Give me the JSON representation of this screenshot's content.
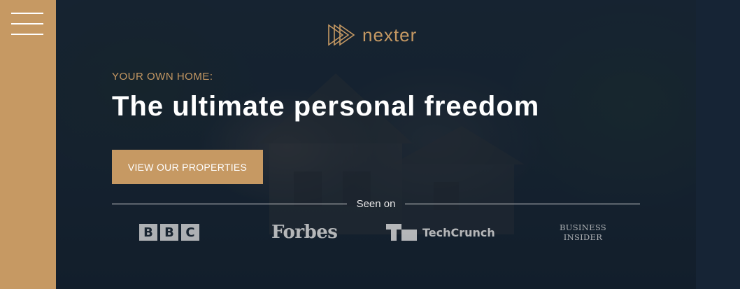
{
  "header": {
    "logo_text": "nexter",
    "subtitle": "YOUR OWN HOME:",
    "title": "The ultimate personal freedom",
    "cta_label": "VIEW OUR PROPERTIES"
  },
  "seen_on": {
    "label": "Seen on",
    "logos": [
      {
        "name": "bbc-logo",
        "text": "BBC"
      },
      {
        "name": "forbes-logo",
        "text": "Forbes"
      },
      {
        "name": "techcrunch-logo",
        "text": "TechCrunch"
      },
      {
        "name": "business-insider-logo",
        "line1": "BUSINESS",
        "line2": "INSIDER"
      }
    ]
  },
  "colors": {
    "accent": "#c69963",
    "dark": "#101d2c",
    "text": "#ffffff"
  },
  "icons": {
    "menu": "hamburger-menu-icon",
    "logo_mark": "play-triangles-icon"
  }
}
